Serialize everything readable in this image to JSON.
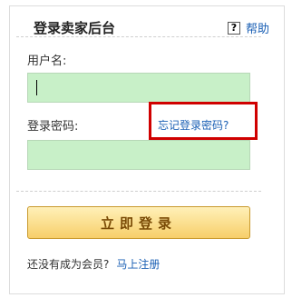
{
  "panel": {
    "title": "登录卖家后台",
    "help_icon_text": "?",
    "help_label": "帮助"
  },
  "form": {
    "username_label": "用户名:",
    "username_value": "",
    "password_label": "登录密码:",
    "password_value": "",
    "forgot_label": "忘记登录密码?",
    "forgot_highlight_color": "#d00000"
  },
  "buttons": {
    "login_label": "立即登录"
  },
  "footer": {
    "prompt": "还没有成为会员?",
    "register_label": "马上注册"
  },
  "colors": {
    "field_bg": "#c8f0c8",
    "link": "#1a5fb4",
    "button_bg": "#f7cf6a"
  }
}
